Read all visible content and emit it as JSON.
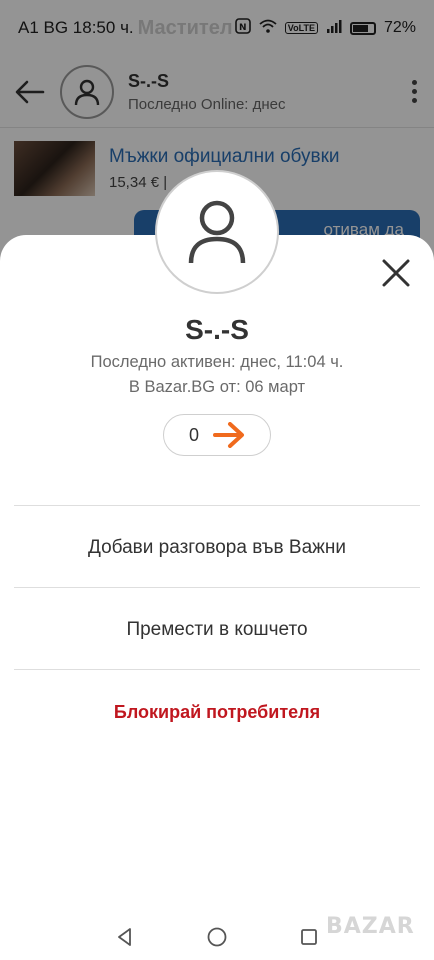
{
  "status_bar": {
    "left_text": "A1 BG 18:50 ч.",
    "watermark_overlay": "Мастител 977216",
    "battery": "72%",
    "volte": "VoLTE"
  },
  "chat_header": {
    "name": "S-.-S",
    "status": "Последно Online: днес"
  },
  "product": {
    "title": "Мъжки официални обувки",
    "price": "15,34 € |"
  },
  "message_preview": "отивам да",
  "profile_sheet": {
    "name": "S-.-S",
    "last_active": "Последно активен: днес, 11:04 ч.",
    "member_since": "В Bazar.BG от: 06 март",
    "rating_count": "0",
    "actions": [
      {
        "label": "Добави разговора във Важни"
      },
      {
        "label": "Премести в кошчето"
      },
      {
        "label": "Блокирай потребителя"
      }
    ]
  },
  "watermark": "BAZAR",
  "colors": {
    "accent_blue": "#2a6db5",
    "danger_red": "#c0171f",
    "arrow_orange": "#f06a1d"
  },
  "icons": [
    "back-arrow-icon",
    "user-icon",
    "more-vertical-icon",
    "close-icon",
    "arrow-right-icon",
    "nav-back-icon",
    "nav-home-icon",
    "nav-recents-icon"
  ]
}
